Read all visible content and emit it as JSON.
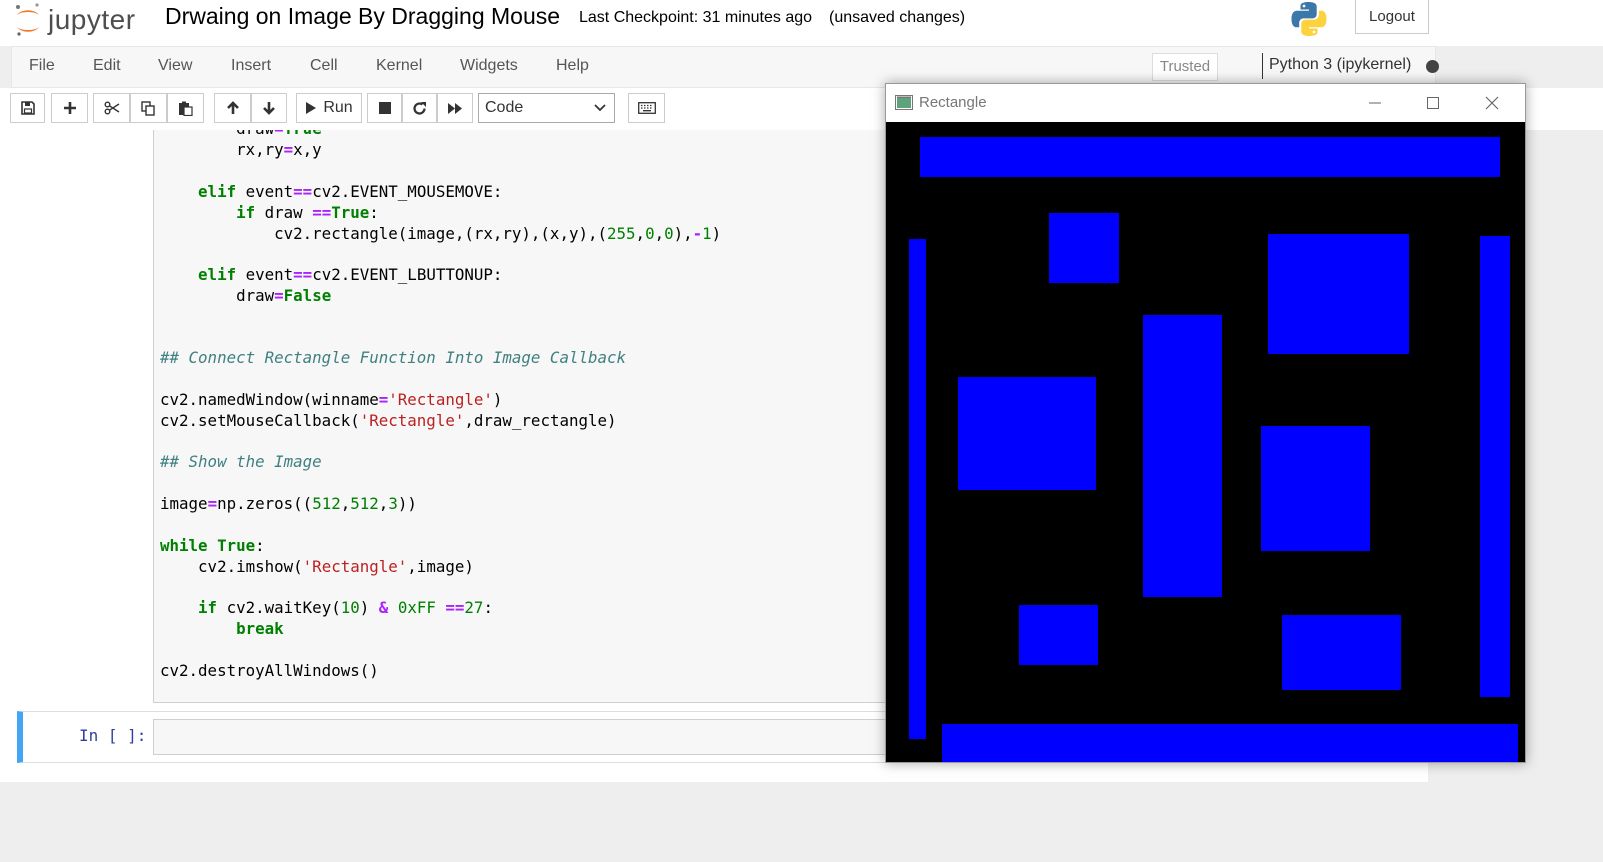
{
  "header": {
    "logo_text": "jupyter",
    "notebook_title": "Drwaing on Image By Dragging Mouse",
    "checkpoint": "Last Checkpoint: 31 minutes ago",
    "unsaved": "(unsaved changes)",
    "logout_label": "Logout"
  },
  "menu": {
    "items": [
      "File",
      "Edit",
      "View",
      "Insert",
      "Cell",
      "Kernel",
      "Widgets",
      "Help"
    ],
    "trusted": "Trusted",
    "kernel": "Python 3 (ipykernel)"
  },
  "toolbar": {
    "run_label": "Run",
    "cell_type": "Code"
  },
  "code_lines": [
    "        draw=True",
    "        rx,ry=x,y",
    "",
    "    elif event==cv2.EVENT_MOUSEMOVE:",
    "        if draw ==True:",
    "            cv2.rectangle(image,(rx,ry),(x,y),(255,0,0),-1)",
    "",
    "    elif event==cv2.EVENT_LBUTTONUP:",
    "        draw=False",
    "",
    "",
    "## Connect Rectangle Function Into Image Callback",
    "",
    "cv2.namedWindow(winname='Rectangle')",
    "cv2.setMouseCallback('Rectangle',draw_rectangle)",
    "",
    "## Show the Image",
    "",
    "image=np.zeros((512,512,3))",
    "",
    "while True:",
    "    cv2.imshow('Rectangle',image)",
    "",
    "    if cv2.waitKey(10) & 0xFF ==27:",
    "        break",
    "",
    "cv2.destroyAllWindows()"
  ],
  "new_cell": {
    "prompt": "In [ ]:"
  },
  "cv_window": {
    "title": "Rectangle",
    "fill_color": "#0000ff",
    "background_color": "#000000"
  },
  "colors": {
    "accent_cell_border": "#42a5f5",
    "jupyter_orange": "#f37726"
  }
}
